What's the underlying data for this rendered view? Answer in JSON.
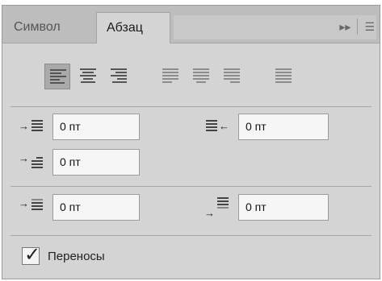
{
  "tabs": {
    "symbol": "Символ",
    "paragraph": "Абзац"
  },
  "menu": {
    "collapse_icon": "double-chevron-right",
    "options_icon": "panel-menu"
  },
  "alignment": {
    "buttons": [
      {
        "name": "align-left",
        "selected": true
      },
      {
        "name": "align-center",
        "selected": false
      },
      {
        "name": "align-right",
        "selected": false
      },
      {
        "name": "justify-last-left",
        "selected": false
      },
      {
        "name": "justify-last-center",
        "selected": false
      },
      {
        "name": "justify-last-right",
        "selected": false
      },
      {
        "name": "justify-all",
        "selected": false
      }
    ]
  },
  "indents": {
    "left_indent": "0 пт",
    "right_indent": "0 пт",
    "first_line_indent": "0 пт"
  },
  "spacing": {
    "space_before": "0 пт",
    "space_after": "0 пт"
  },
  "hyphenation": {
    "label": "Переносы",
    "checked": true
  }
}
